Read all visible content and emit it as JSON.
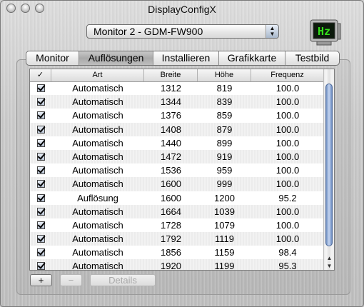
{
  "window": {
    "title": "DisplayConfigX"
  },
  "monitor_select": {
    "value": "Monitor 2 - GDM-FW900"
  },
  "logo_text": "Hz",
  "tabs": [
    {
      "label": "Monitor",
      "selected": false
    },
    {
      "label": "Auflösungen",
      "selected": true
    },
    {
      "label": "Installieren",
      "selected": false
    },
    {
      "label": "Grafikkarte",
      "selected": false
    },
    {
      "label": "Testbild",
      "selected": false
    }
  ],
  "table": {
    "headers": {
      "check": "✓",
      "art": "Art",
      "breite": "Breite",
      "hoehe": "Höhe",
      "frequenz": "Frequenz"
    },
    "rows": [
      {
        "checked": true,
        "art": "Automatisch",
        "breite": "1312",
        "hoehe": "819",
        "frequenz": "100.0"
      },
      {
        "checked": true,
        "art": "Automatisch",
        "breite": "1344",
        "hoehe": "839",
        "frequenz": "100.0"
      },
      {
        "checked": true,
        "art": "Automatisch",
        "breite": "1376",
        "hoehe": "859",
        "frequenz": "100.0"
      },
      {
        "checked": true,
        "art": "Automatisch",
        "breite": "1408",
        "hoehe": "879",
        "frequenz": "100.0"
      },
      {
        "checked": true,
        "art": "Automatisch",
        "breite": "1440",
        "hoehe": "899",
        "frequenz": "100.0"
      },
      {
        "checked": true,
        "art": "Automatisch",
        "breite": "1472",
        "hoehe": "919",
        "frequenz": "100.0"
      },
      {
        "checked": true,
        "art": "Automatisch",
        "breite": "1536",
        "hoehe": "959",
        "frequenz": "100.0"
      },
      {
        "checked": true,
        "art": "Automatisch",
        "breite": "1600",
        "hoehe": "999",
        "frequenz": "100.0"
      },
      {
        "checked": true,
        "art": "Auflösung",
        "breite": "1600",
        "hoehe": "1200",
        "frequenz": "95.2"
      },
      {
        "checked": true,
        "art": "Automatisch",
        "breite": "1664",
        "hoehe": "1039",
        "frequenz": "100.0"
      },
      {
        "checked": true,
        "art": "Automatisch",
        "breite": "1728",
        "hoehe": "1079",
        "frequenz": "100.0"
      },
      {
        "checked": true,
        "art": "Automatisch",
        "breite": "1792",
        "hoehe": "1119",
        "frequenz": "100.0"
      },
      {
        "checked": true,
        "art": "Automatisch",
        "breite": "1856",
        "hoehe": "1159",
        "frequenz": "98.4"
      },
      {
        "checked": true,
        "art": "Automatisch",
        "breite": "1920",
        "hoehe": "1199",
        "frequenz": "95.3"
      }
    ]
  },
  "buttons": {
    "add": "+",
    "remove": "−",
    "details": "Details"
  },
  "colors": {
    "logo_text": "#34e01a",
    "scroll_thumb": "#7f9fd1"
  }
}
